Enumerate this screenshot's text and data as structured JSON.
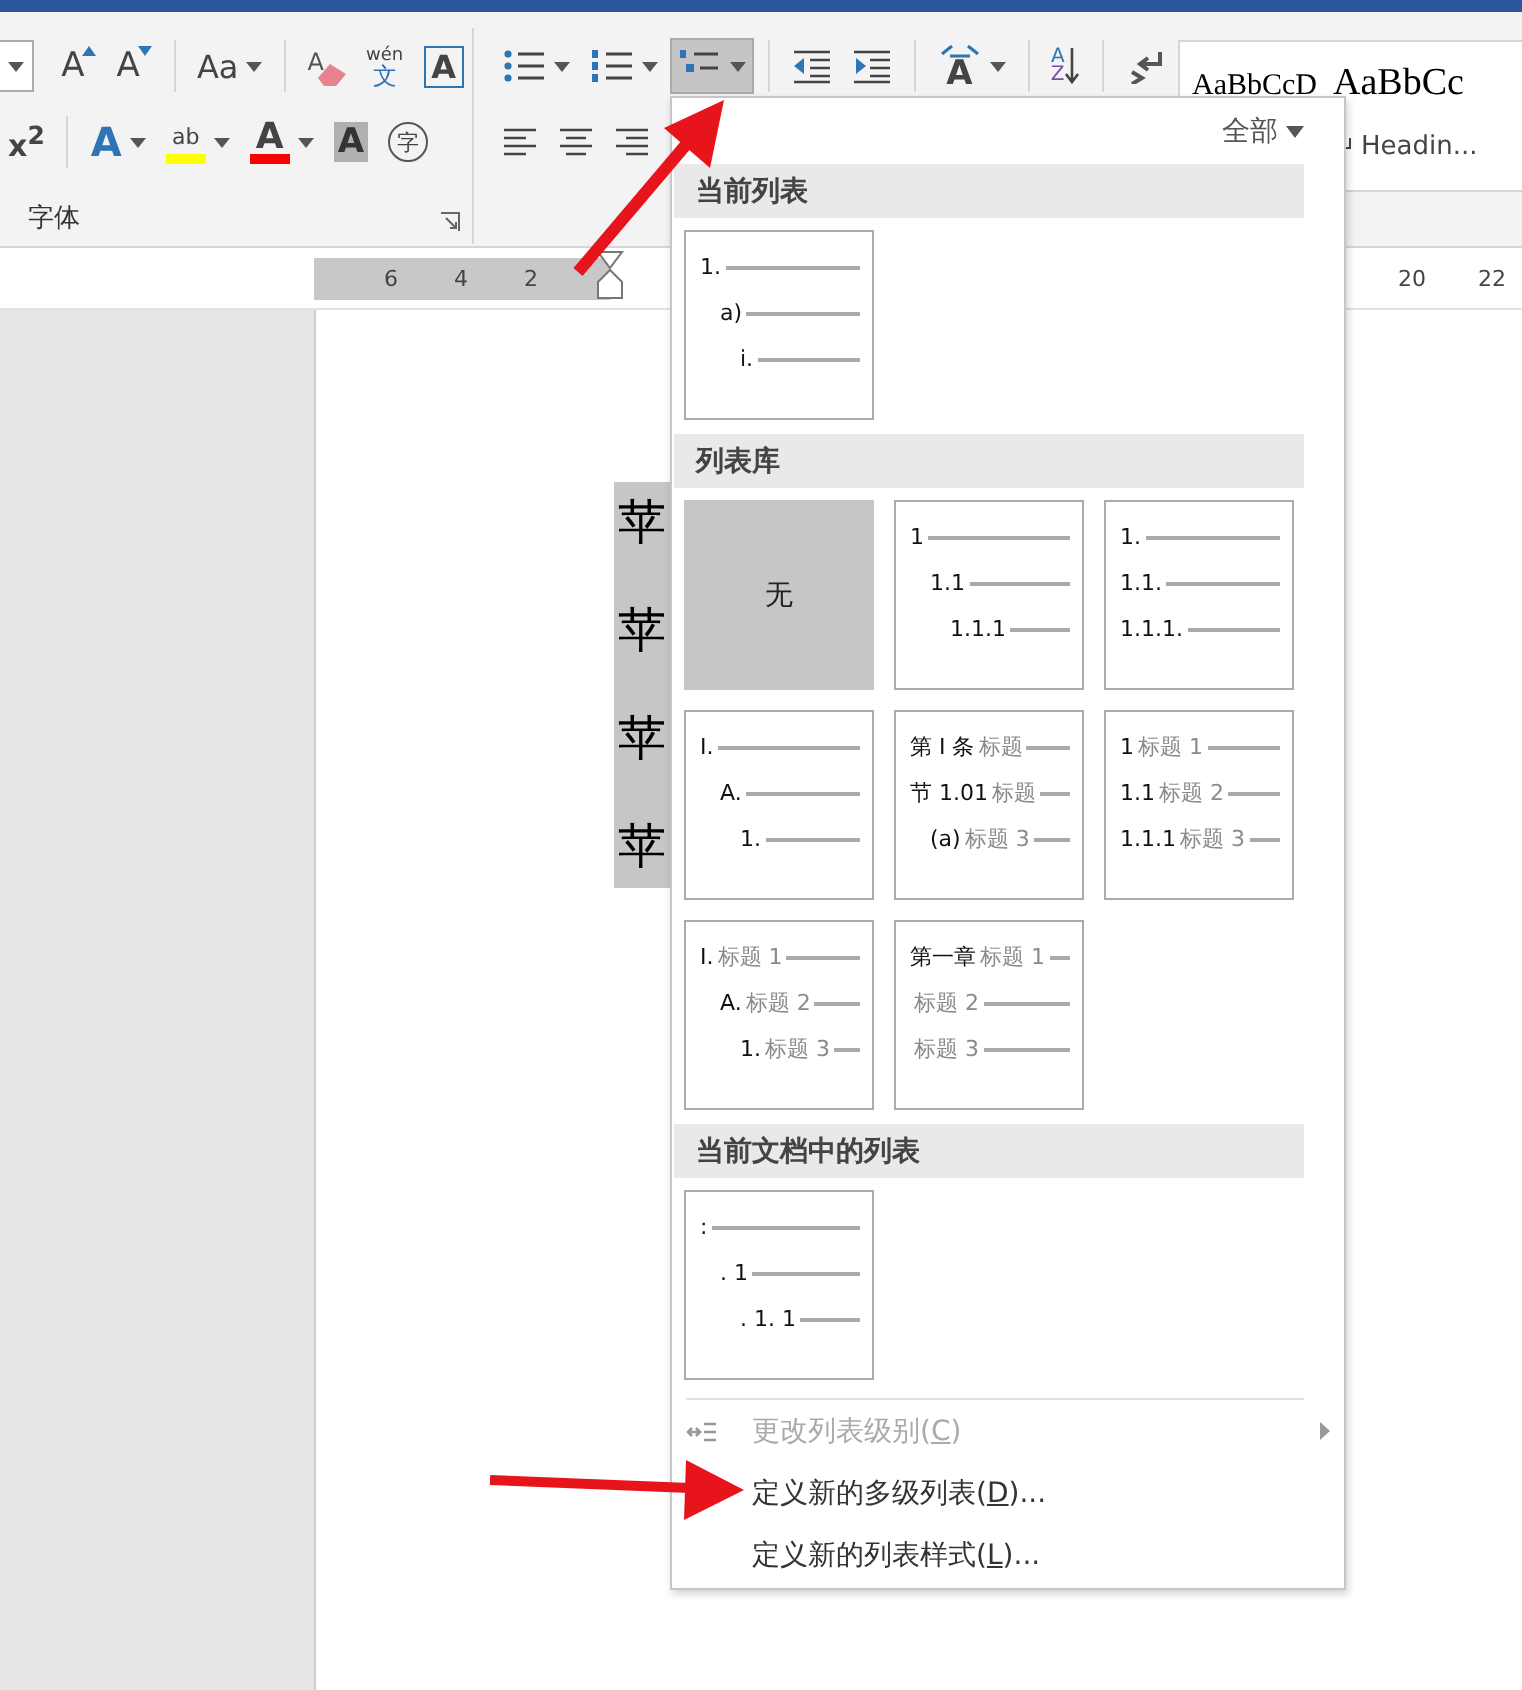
{
  "ribbon": {
    "font_group": {
      "label": "字体",
      "row1": [
        {
          "kind": "size-field",
          "has_menu": true
        },
        {
          "kind": "grow-font",
          "glyph": "A"
        },
        {
          "kind": "shrink-font",
          "glyph": "A"
        },
        {
          "kind": "separator"
        },
        {
          "kind": "change-case",
          "glyph": "Aa",
          "has_menu": true
        },
        {
          "kind": "separator"
        },
        {
          "kind": "clear-format",
          "glyph": "A"
        },
        {
          "kind": "phonetic",
          "glyph": "wén",
          "sub": "文"
        },
        {
          "kind": "char-border",
          "glyph": "A"
        }
      ],
      "row2": [
        {
          "kind": "superscript",
          "glyph": "x$^{2}$"
        },
        {
          "kind": "separator"
        },
        {
          "kind": "text-effect",
          "glyph": "A",
          "has_menu": true
        },
        {
          "kind": "highlight",
          "glyph": "ab",
          "color": "#ffff00",
          "has_menu": true
        },
        {
          "kind": "font-color",
          "glyph": "A",
          "color": "#ff0000",
          "has_menu": true
        },
        {
          "kind": "shading",
          "glyph": "A"
        },
        {
          "kind": "enclose",
          "glyph": "字"
        }
      ]
    },
    "paragraph_group": {
      "row1": [
        {
          "kind": "bullets",
          "has_menu": true,
          "selected": false
        },
        {
          "kind": "numbering",
          "has_menu": true,
          "selected": false
        },
        {
          "kind": "multilevel",
          "has_menu": true,
          "selected": true
        },
        {
          "kind": "separator"
        },
        {
          "kind": "outdent",
          "selected": false
        },
        {
          "kind": "indent",
          "selected": false
        },
        {
          "kind": "separator"
        },
        {
          "kind": "asian-layout",
          "glyph": "A",
          "has_menu": true,
          "selected": false
        },
        {
          "kind": "separator"
        },
        {
          "kind": "sort",
          "glyph": "A",
          "sub": "Z",
          "selected": false
        },
        {
          "kind": "separator"
        },
        {
          "kind": "marks",
          "selected": false
        }
      ],
      "row2": [
        {
          "kind": "align-left"
        },
        {
          "kind": "align-center"
        },
        {
          "kind": "align-right"
        }
      ]
    },
    "styles": [
      {
        "sample": "AaBbCcD"
      },
      {
        "sample": "AaBbCc",
        "caption": "Headin..."
      }
    ]
  },
  "ruler": {
    "left_numbers": [
      "6",
      "4",
      "2"
    ],
    "right_numbers": [
      "20",
      "22"
    ]
  },
  "document": {
    "selected_chars": [
      "苹",
      "苹",
      "苹",
      "苹"
    ]
  },
  "dropdown": {
    "filter": "全部",
    "sections": [
      {
        "title": "当前列表",
        "tiles": [
          {
            "kind": "list",
            "selected": false,
            "lines": [
              {
                "number": "1.",
                "children": [
                  {
                    "number": "a)",
                    "children": [
                      {
                        "number": "i."
                      }
                    ]
                  }
                ]
              }
            ]
          }
        ]
      },
      {
        "title": "列表库",
        "tiles": [
          {
            "kind": "none",
            "label": "无",
            "selected": true
          },
          {
            "kind": "list",
            "selected": false,
            "lines": [
              {
                "number": "1",
                "children": [
                  {
                    "number": "1.1",
                    "children": [
                      {
                        "number": "1.1.1"
                      }
                    ]
                  }
                ]
              }
            ]
          },
          {
            "kind": "list",
            "selected": false,
            "lines": [
              {
                "number": "1."
              },
              {
                "number": "1.1."
              },
              {
                "number": "1.1.1."
              }
            ]
          },
          {
            "kind": "list",
            "selected": false,
            "lines": [
              {
                "number": "I.",
                "children": [
                  {
                    "number": "A.",
                    "children": [
                      {
                        "number": "1."
                      }
                    ]
                  }
                ]
              }
            ]
          },
          {
            "kind": "list",
            "selected": false,
            "lines": [
              {
                "number": "第 I 条",
                "heading": "标题"
              },
              {
                "number": "节 1.01",
                "heading": "标题",
                "children": [
                  {
                    "number": "(a)",
                    "heading": "标题 3"
                  }
                ]
              }
            ]
          },
          {
            "kind": "list",
            "selected": false,
            "lines": [
              {
                "number": "1",
                "heading": "标题 1"
              },
              {
                "number": "1.1",
                "heading": "标题 2"
              },
              {
                "number": "1.1.1",
                "heading": "标题 3"
              }
            ]
          },
          {
            "kind": "list",
            "selected": false,
            "lines": [
              {
                "number": "I.",
                "heading": "标题 1",
                "children": [
                  {
                    "number": "A.",
                    "heading": "标题 2",
                    "children": [
                      {
                        "number": "1.",
                        "heading": "标题 3"
                      }
                    ]
                  }
                ]
              }
            ]
          },
          {
            "kind": "list",
            "selected": false,
            "lines": [
              {
                "number": "第一章",
                "heading": "标题 1"
              },
              {
                "heading": "标题 2"
              },
              {
                "heading": "标题 3"
              }
            ]
          }
        ]
      },
      {
        "title": "当前文档中的列表",
        "tiles": [
          {
            "kind": "list",
            "selected": false,
            "lines": [
              {
                "number": ":",
                "children": [
                  {
                    "number": ". 1",
                    "children": [
                      {
                        "number": ". 1. 1"
                      }
                    ]
                  }
                ]
              }
            ]
          }
        ]
      }
    ],
    "menu": [
      {
        "before": "更改列表级别(",
        "key": "C",
        "after": ")",
        "disabled": true,
        "icon": true,
        "submenu": true
      },
      {
        "before": "定义新的多级列表(",
        "key": "D",
        "after": ")...",
        "disabled": false,
        "icon": false,
        "submenu": false
      },
      {
        "before": "定义新的列表样式(",
        "key": "L",
        "after": ")...",
        "disabled": false,
        "icon": false,
        "submenu": false
      }
    ]
  }
}
